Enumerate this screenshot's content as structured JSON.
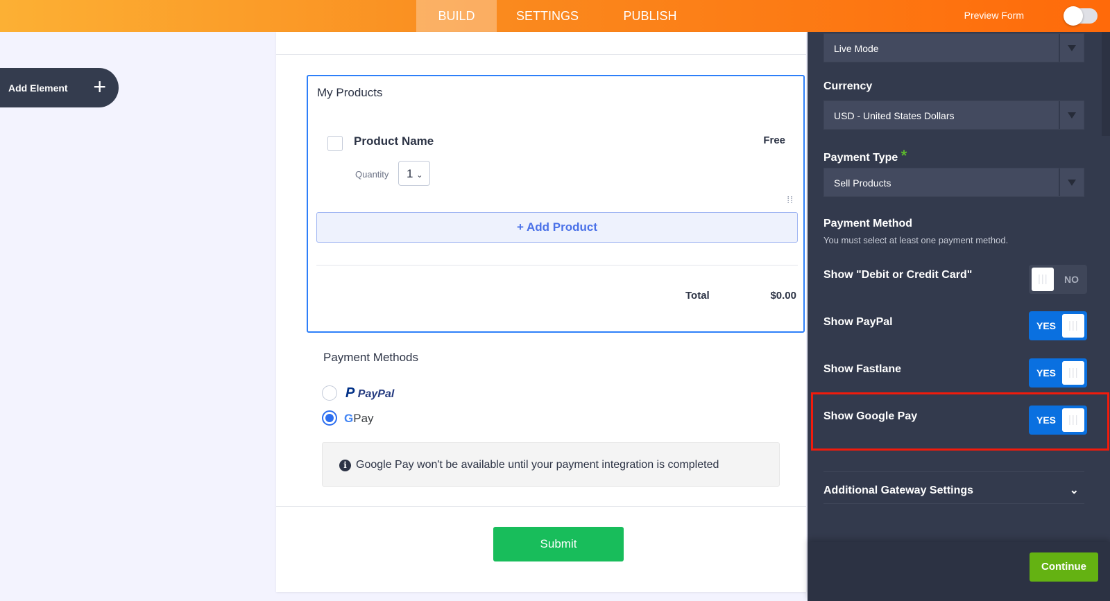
{
  "topbar": {
    "tabs": [
      "BUILD",
      "SETTINGS",
      "PUBLISH"
    ],
    "active_tab": "BUILD",
    "preview_label": "Preview Form",
    "preview_on": false
  },
  "sidebar": {
    "add_element": "Add Element"
  },
  "form": {
    "products": {
      "title": "My Products",
      "product_name": "Product Name",
      "price": "Free",
      "quantity_label": "Quantity",
      "quantity_value": "1",
      "add_product": "+ Add Product",
      "total_label": "Total",
      "total_value": "$0.00"
    },
    "payment_methods": {
      "title": "Payment Methods",
      "options": [
        {
          "label": "PayPal",
          "selected": false
        },
        {
          "label": "Pay",
          "selected": true
        }
      ],
      "notice": "Google Pay won't be available until your payment integration is completed"
    },
    "submit": "Submit"
  },
  "panel": {
    "mode": "Live Mode",
    "currency_label": "Currency",
    "currency": "USD - United States Dollars",
    "payment_type_label": "Payment Type",
    "required_mark": "*",
    "payment_type": "Sell Products",
    "payment_method_label": "Payment Method",
    "payment_method_hint": "You must select at least one payment method.",
    "toggles": [
      {
        "label": "Show \"Debit or Credit Card\"",
        "state": "NO"
      },
      {
        "label": "Show PayPal",
        "state": "YES"
      },
      {
        "label": "Show Fastlane",
        "state": "YES"
      },
      {
        "label": "Show Google Pay",
        "state": "YES"
      }
    ],
    "additional": "Additional Gateway Settings",
    "continue": "Continue"
  },
  "colors": {
    "accent": "#0a70e0",
    "highlight": "#f11b0c",
    "submit": "#18bd5b",
    "continue": "#64b212"
  }
}
